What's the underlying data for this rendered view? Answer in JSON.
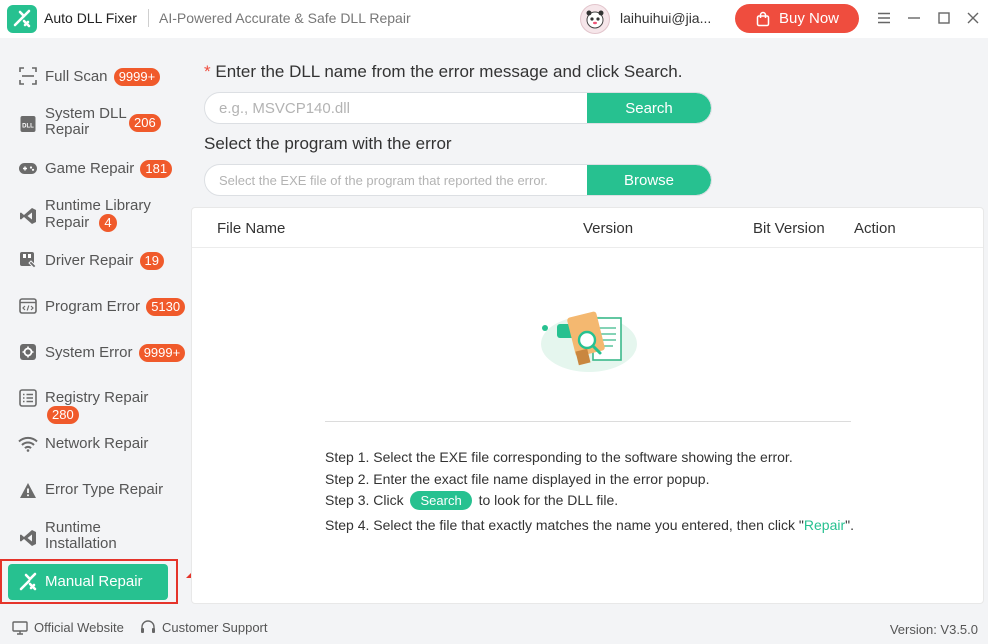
{
  "app": {
    "name": "Auto DLL Fixer",
    "tagline": "AI-Powered Accurate & Safe DLL Repair",
    "user_email": "laihuihui@jia...",
    "buy_label": "Buy Now"
  },
  "sidebar": {
    "items": [
      {
        "label": "Full Scan",
        "badge": "9999+"
      },
      {
        "label_line1": "System DLL",
        "label_line2": "Repair",
        "badge": "206"
      },
      {
        "label": "Game Repair",
        "badge": "181"
      },
      {
        "label_line1": "Runtime Library",
        "label_line2": "Repair",
        "badge": "4"
      },
      {
        "label": "Driver Repair",
        "badge": "19"
      },
      {
        "label": "Program Error",
        "badge": "5130"
      },
      {
        "label": "System Error",
        "badge": "9999+"
      },
      {
        "label": "Registry Repair",
        "badge": "280"
      },
      {
        "label": "Network Repair"
      },
      {
        "label": "Error Type Repair"
      },
      {
        "label_line1": "Runtime",
        "label_line2": "Installation"
      },
      {
        "label": "Manual Repair"
      }
    ]
  },
  "main": {
    "dll_prompt_star": "*",
    "dll_prompt": "Enter the DLL name from the error message and click Search.",
    "dll_placeholder": "e.g., MSVCP140.dll",
    "search_label": "Search",
    "program_prompt": "Select the program with the error",
    "exe_placeholder": "Select the EXE file of the program that reported the error.",
    "browse_label": "Browse",
    "table": {
      "columns": [
        "File Name",
        "Version",
        "Bit Version",
        "Action"
      ]
    },
    "steps": {
      "step1": "Step 1. Select the EXE file corresponding to the software showing the error.",
      "step2": "Step 2. Enter the exact file name displayed in the error popup.",
      "step3_prefix": "Step 3. Click",
      "step3_button": "Search",
      "step3_suffix": "to look for the DLL file.",
      "step4_prefix": "Step 4. Select the file that exactly matches the name you entered, then click \"",
      "step4_link": "Repair",
      "step4_suffix": "\"."
    }
  },
  "footer": {
    "official_website": "Official Website",
    "customer_support": "Customer Support",
    "version": "Version: V3.5.0"
  },
  "colors": {
    "accent": "#27c190",
    "buy": "#ef4d3e",
    "badge": "#f05a2b",
    "highlight_box": "#e5342a"
  }
}
